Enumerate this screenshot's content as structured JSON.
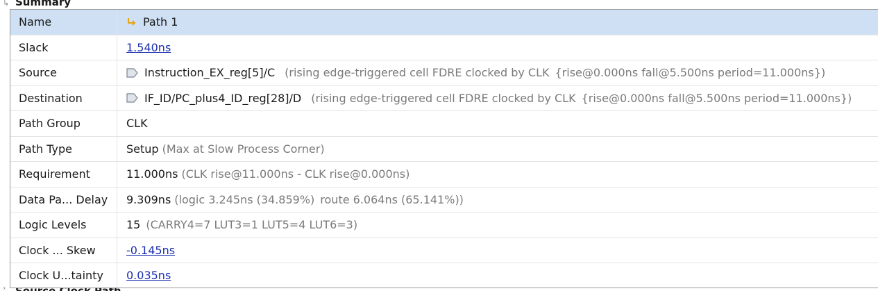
{
  "background": {
    "top_section_title": "Summary",
    "bottom_section_title": "Source Clock Path"
  },
  "rows": {
    "name": {
      "label": "Name",
      "value": "Path 1",
      "icon": "path-icon"
    },
    "slack": {
      "label": "Slack",
      "value": "1.540ns"
    },
    "source": {
      "label": "Source",
      "value": "Instruction_EX_reg[5]/C",
      "detail": "(rising edge-triggered cell FDRE clocked by CLK",
      "clock": "{rise@0.000ns fall@5.500ns period=11.000ns})",
      "icon": "cell-pin-icon"
    },
    "destination": {
      "label": "Destination",
      "value": "IF_ID/PC_plus4_ID_reg[28]/D",
      "detail": "(rising edge-triggered cell FDRE clocked by CLK",
      "clock": "{rise@0.000ns fall@5.500ns period=11.000ns})",
      "icon": "cell-pin-icon"
    },
    "path_group": {
      "label": "Path Group",
      "value": "CLK"
    },
    "path_type": {
      "label": "Path Type",
      "value": "Setup",
      "detail": "(Max at Slow Process Corner)"
    },
    "requirement": {
      "label": "Requirement",
      "value": "11.000ns",
      "detail": "(CLK rise@11.000ns - CLK rise@0.000ns)"
    },
    "data_path_delay": {
      "label": "Data Pa... Delay",
      "value": "9.309ns",
      "detail": "(logic 3.245ns (34.859%)",
      "route": "route 6.064ns (65.141%))"
    },
    "logic_levels": {
      "label": "Logic Levels",
      "value": "15",
      "detail": "(CARRY4=7 LUT3=1 LUT5=4 LUT6=3)"
    },
    "clock_skew": {
      "label": "Clock ... Skew",
      "value": "-0.145ns"
    },
    "clock_uncertainty": {
      "label": "Clock U...tainty",
      "value": "0.035ns"
    }
  },
  "colors": {
    "selected_row": "#cfe0f5",
    "link": "#1a2fb0",
    "muted_text": "#7a7a7a",
    "path_icon": "#e8a317",
    "cell_icon": "#7a8594"
  }
}
